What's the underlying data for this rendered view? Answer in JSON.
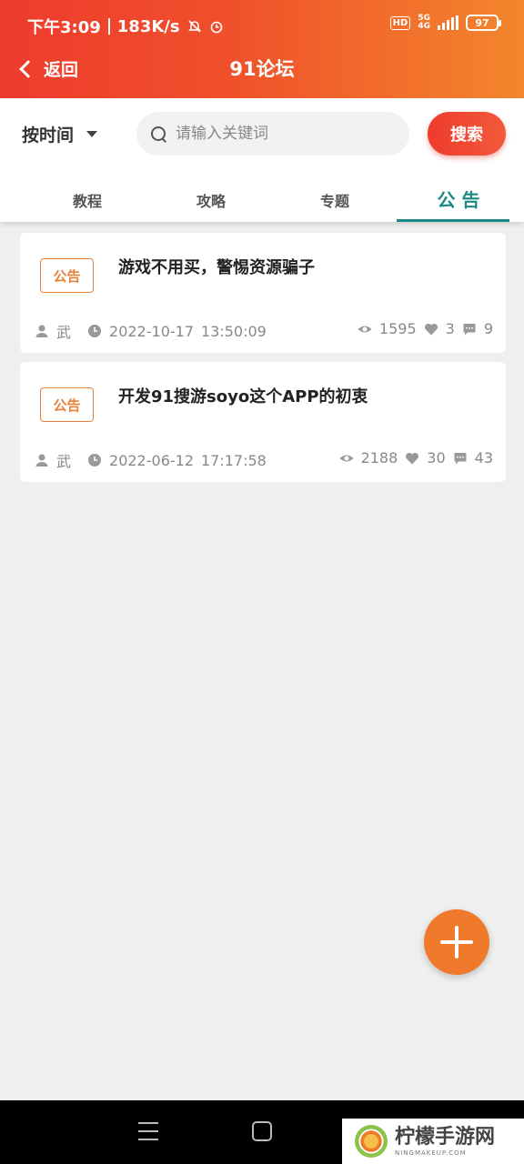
{
  "status_bar": {
    "time": "下午3:09",
    "net_speed": "183K/s",
    "hd": "HD",
    "network": "5G",
    "network_sub": "4G",
    "battery": "97"
  },
  "nav": {
    "back_label": "返回",
    "title": "91论坛"
  },
  "filter": {
    "sort_label": "按时间",
    "search_placeholder": "请输入关键词",
    "search_button": "搜索"
  },
  "tabs": [
    {
      "label": "教程"
    },
    {
      "label": "攻略"
    },
    {
      "label": "专题"
    },
    {
      "label": "公 告",
      "active": true
    }
  ],
  "posts": [
    {
      "badge": "公告",
      "title": "游戏不用买，警惕资源骗子",
      "author": "武",
      "date": "2022-10-17",
      "time": "13:50:09",
      "views": "1595",
      "likes": "3",
      "comments": "9"
    },
    {
      "badge": "公告",
      "title": "开发91搜游soyo这个APP的初衷",
      "author": "武",
      "date": "2022-06-12",
      "time": "17:17:58",
      "views": "2188",
      "likes": "30",
      "comments": "43"
    }
  ],
  "watermark": {
    "main": "柠檬手游网",
    "sub": "NINGMAKEUP.COM"
  },
  "colors": {
    "header_start": "#ee3b2d",
    "header_end": "#f3862c",
    "accent_tab": "#1a8a86",
    "badge": "#e8823a",
    "fab": "#f07a2b"
  }
}
